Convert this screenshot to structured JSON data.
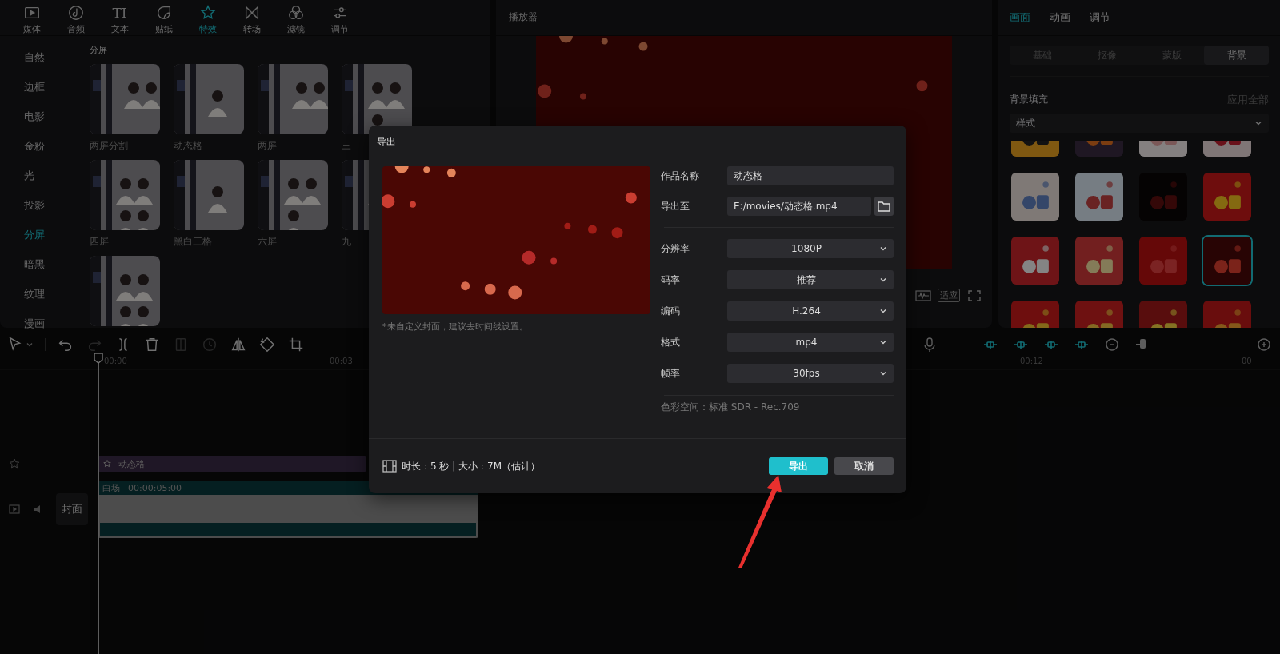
{
  "effects_panel": {
    "tabs": [
      {
        "kind": "media",
        "label": "媒体",
        "selected": false
      },
      {
        "kind": "audio",
        "label": "音频",
        "selected": false
      },
      {
        "kind": "text",
        "icon_text": "TI",
        "label": "文本",
        "selected": false
      },
      {
        "kind": "sticker",
        "label": "贴纸",
        "selected": false
      },
      {
        "kind": "effect",
        "label": "特效",
        "selected": true
      },
      {
        "kind": "transition",
        "label": "转场",
        "selected": false
      },
      {
        "kind": "filter",
        "label": "滤镜",
        "selected": false
      },
      {
        "kind": "adjust",
        "label": "调节",
        "selected": false
      }
    ],
    "categories": [
      {
        "label": "自然",
        "selected": false
      },
      {
        "label": "边框",
        "selected": false
      },
      {
        "label": "电影",
        "selected": false
      },
      {
        "label": "金粉",
        "selected": false
      },
      {
        "label": "光",
        "selected": false
      },
      {
        "label": "投影",
        "selected": false
      },
      {
        "label": "分屏",
        "selected": true
      },
      {
        "label": "暗黑",
        "selected": false
      },
      {
        "label": "纹理",
        "selected": false
      },
      {
        "label": "漫画",
        "selected": false
      }
    ],
    "section_title": "分屏",
    "effects": [
      {
        "kind": "picture",
        "label": "两屏分割"
      },
      {
        "kind": "picture",
        "label": "动态格"
      },
      {
        "kind": "picture",
        "label": "两屏"
      },
      {
        "kind": "picture",
        "label": "三"
      },
      {
        "kind": "picture",
        "label": "四屏"
      },
      {
        "kind": "picture",
        "label": "黑白三格"
      },
      {
        "kind": "picture",
        "label": "六屏"
      },
      {
        "kind": "picture",
        "label": "九"
      },
      {
        "kind": "picture"
      }
    ]
  },
  "player": {
    "title": "播放器",
    "fit_label": "适应"
  },
  "inspector": {
    "tabs": [
      {
        "label": "画面",
        "selected": true
      },
      {
        "label": "动画",
        "selected": false
      },
      {
        "label": "调节",
        "selected": false
      }
    ],
    "segments": [
      {
        "label": "基础",
        "selected": false
      },
      {
        "label": "抠像",
        "selected": false
      },
      {
        "label": "蒙版",
        "selected": false
      },
      {
        "label": "背景",
        "selected": true
      }
    ],
    "section_title": "背景填充",
    "apply_all": "应用全部",
    "style_select": "样式",
    "swatches": [
      {
        "kind": "picture",
        "selected": false
      },
      {
        "kind": "picture",
        "selected": false
      },
      {
        "kind": "picture",
        "selected": false
      },
      {
        "kind": "picture",
        "selected": false
      },
      {
        "kind": "picture",
        "selected": false
      },
      {
        "kind": "picture",
        "selected": false
      },
      {
        "kind": "picture",
        "selected": false
      },
      {
        "kind": "picture",
        "selected": false
      },
      {
        "kind": "picture",
        "selected": false
      },
      {
        "kind": "picture",
        "selected": false
      },
      {
        "kind": "picture",
        "selected": false
      },
      {
        "kind": "picture",
        "selected": true
      },
      {
        "kind": "picture",
        "selected": false
      },
      {
        "kind": "picture",
        "selected": false
      },
      {
        "kind": "picture",
        "selected": false
      },
      {
        "kind": "picture",
        "selected": false
      }
    ]
  },
  "timeline": {
    "tools": [
      {
        "kind": "select",
        "disabled": false
      },
      {
        "kind": "undo",
        "disabled": false
      },
      {
        "kind": "redo",
        "disabled": true
      },
      {
        "kind": "split",
        "disabled": false
      },
      {
        "kind": "delete",
        "disabled": false
      },
      {
        "kind": "freeze",
        "disabled": true
      },
      {
        "kind": "reverse",
        "disabled": true
      },
      {
        "kind": "mirror",
        "disabled": false
      },
      {
        "kind": "rotate",
        "disabled": false
      },
      {
        "kind": "crop",
        "disabled": false
      }
    ],
    "ruler": [
      {
        "label": "00:00"
      },
      {
        "label": "00:03"
      },
      {
        "label": "00:12"
      },
      {
        "label": "00"
      }
    ],
    "effect_clip": {
      "label": "动态格"
    },
    "video_clip": {
      "label": "白场",
      "duration": "00:00:05:00"
    },
    "cover_button": "封面"
  },
  "dialog": {
    "title": "导出",
    "cover_note": "*未自定义封面，建议去时间线设置。",
    "fields": [
      {
        "kind": "text",
        "label": "作品名称",
        "value": "动态格"
      },
      {
        "kind": "path",
        "label": "导出至",
        "value": "E:/movies/动态格.mp4"
      }
    ],
    "settings": [
      {
        "label": "分辨率",
        "value": "1080P"
      },
      {
        "label": "码率",
        "value": "推荐"
      },
      {
        "label": "编码",
        "value": "H.264"
      },
      {
        "label": "格式",
        "value": "mp4"
      },
      {
        "label": "帧率",
        "value": "30fps"
      }
    ],
    "color_space": "色彩空间：标准 SDR - Rec.709",
    "summary": "时长：5 秒 | 大小：7M（估计）",
    "export_button": "导出",
    "cancel_button": "取消"
  }
}
